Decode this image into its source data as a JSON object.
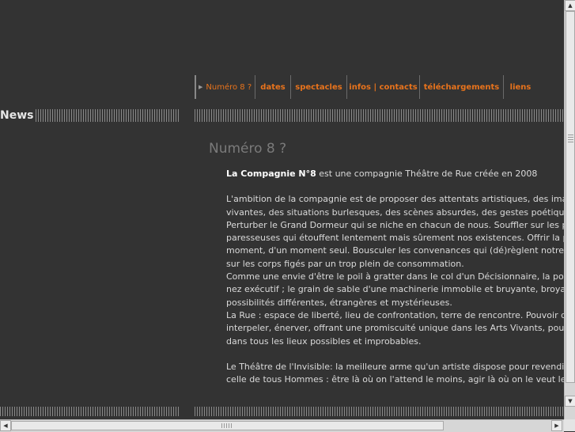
{
  "nav": {
    "items": [
      {
        "label": "Numéro 8 ?",
        "active": true
      },
      {
        "label": "dates"
      },
      {
        "label": "spectacles"
      },
      {
        "label": "infos | contacts"
      },
      {
        "label": "téléchargements"
      },
      {
        "label": "liens"
      }
    ]
  },
  "sidebar": {
    "news_label": "News"
  },
  "content": {
    "title": "Numéro 8 ?",
    "intro_bold": "La Compagnie N°8",
    "intro_rest": " est une compagnie Théâtre de Rue créée en 2008",
    "p2": [
      "L'ambition de la compagnie est de proposer des attentats artistiques, des images",
      "vivantes, des situations burlesques, des scènes absurdes, des gestes poétiques",
      "Perturber le Grand Dormeur qui se niche en chacun de nous. Souffler sur les pou",
      "paresseuses qui étouffent lentement mais sûrement nos existences. Offrir la pos",
      "moment, d'un moment seul.  Bousculer les convenances qui (dé)règlent notre quo",
      "sur les corps figés par un trop plein de consommation.",
      "Comme une envie d'être le poil à gratter dans le col d'un Décisionnaire, la poudre",
      "nez exécutif ; le grain de sable d'une machinerie immobile et bruyante, broyant le",
      "possibilités différentes,  étrangères et mystérieuses.",
      "La Rue :  espace de liberté, lieu de confrontation, terre de rencontre. Pouvoir diver",
      "interpeler, énerver, offrant une promiscuité unique dans les Arts Vivants,  pouvoir",
      "dans tous les lieux possibles et improbables."
    ],
    "p3": [
      "Le Théâtre de l'Invisible: la meilleure arme qu'un artiste dispose pour revendiquer",
      "celle de tous Hommes : être là où on l'attend le moins, agir là où on le veut le moi"
    ]
  },
  "colors": {
    "accent": "#e8731c",
    "background": "#333333",
    "text": "#dadada"
  },
  "icons": {
    "nav_arrow": "▶",
    "scroll_up": "▲",
    "scroll_down": "▼",
    "scroll_left": "◀",
    "scroll_right": "▶"
  }
}
